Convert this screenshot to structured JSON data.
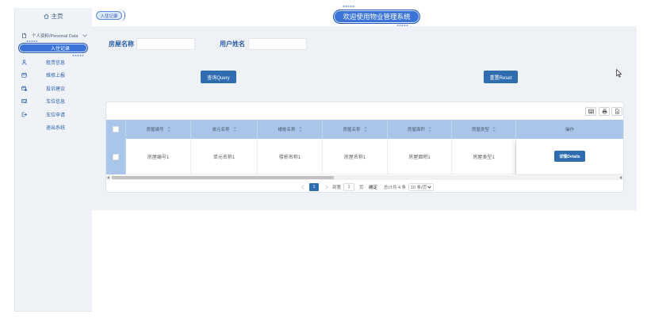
{
  "colors": {
    "primary_button": "#2f6db0",
    "accent_pill": "#3b74d6",
    "table_header": "#a9c5ea",
    "label_text": "#2b5ea8",
    "content_background": "#eef1f6",
    "sidebar_background": "#eff3f8"
  },
  "sidebar": {
    "home_label": "主页",
    "home_icon": "home-icon",
    "group_label": "个人资料/Personal Data",
    "group_icon": "document-icon",
    "active_item": "入住记录",
    "items": [
      {
        "label": "租赁信息",
        "icon": "user-icon"
      },
      {
        "label": "维修上报",
        "icon": "calendar-icon"
      },
      {
        "label": "投诉建议",
        "icon": "calendar-clock-icon"
      },
      {
        "label": "车位信息",
        "icon": "id-card-icon"
      },
      {
        "label": "车位申请",
        "icon": "logout-icon"
      },
      {
        "label": "退出系统"
      }
    ]
  },
  "header": {
    "tab_label": "入住记录",
    "title": "欢迎使用物业管理系统"
  },
  "search": {
    "fields": [
      {
        "label": "房屋名称",
        "value": ""
      },
      {
        "label": "用户姓名",
        "value": ""
      }
    ],
    "query_button": "查询Query",
    "reset_button": "重置Reset"
  },
  "table": {
    "toolbar_icons": [
      "columns-icon",
      "print-icon",
      "export-icon"
    ],
    "columns": [
      "房屋编号",
      "单元名称",
      "楼栋名称",
      "房屋名称",
      "房屋面积",
      "房屋类型",
      "操作"
    ],
    "rows": [
      {
        "cells": [
          "房屋编号1",
          "单元名称1",
          "楼栋名称1",
          "房屋名称1",
          "房屋面积1",
          "房屋类型1"
        ],
        "action": "详情Details"
      }
    ]
  },
  "pagination": {
    "current_page": "1",
    "goto_label": "到第",
    "goto_value": "1",
    "page_suffix": "页",
    "confirm": "确定",
    "total": "总计共 4 条",
    "page_size": "10 条/页"
  }
}
